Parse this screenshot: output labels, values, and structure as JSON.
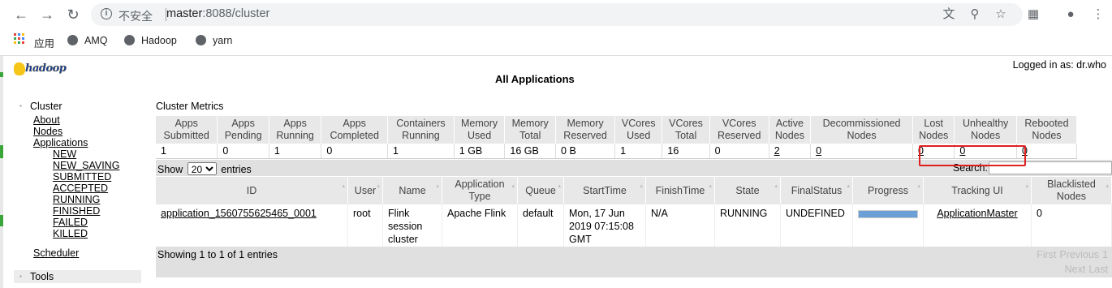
{
  "browser": {
    "insecure_label": "不安全",
    "url_host": "master",
    "url_rest": ":8088/cluster",
    "bookmarks": [
      "应用",
      "AMQ",
      "Hadoop",
      "yarn"
    ]
  },
  "header": {
    "logo_text": "hadoop",
    "logged_in": "Logged in as: dr.who",
    "title": "All Applications"
  },
  "nav": {
    "cluster_label": "Cluster",
    "cluster_links": [
      "About",
      "Nodes",
      "Applications"
    ],
    "app_states": [
      "NEW",
      "NEW_SAVING",
      "SUBMITTED",
      "ACCEPTED",
      "RUNNING",
      "FINISHED",
      "FAILED",
      "KILLED"
    ],
    "scheduler": "Scheduler",
    "tools": "Tools"
  },
  "metrics": {
    "label": "Cluster Metrics",
    "headers": [
      [
        "Apps",
        "Submitted"
      ],
      [
        "Apps",
        "Pending"
      ],
      [
        "Apps",
        "Running"
      ],
      [
        "Apps",
        "Completed"
      ],
      [
        "Containers",
        "Running"
      ],
      [
        "Memory",
        "Used"
      ],
      [
        "Memory",
        "Total"
      ],
      [
        "Memory",
        "Reserved"
      ],
      [
        "VCores",
        "Used"
      ],
      [
        "VCores",
        "Total"
      ],
      [
        "VCores",
        "Reserved"
      ],
      [
        "Active",
        "Nodes"
      ],
      [
        "Decommissioned",
        "Nodes"
      ],
      [
        "Lost",
        "Nodes"
      ],
      [
        "Unhealthy",
        "Nodes"
      ],
      [
        "Rebooted",
        "Nodes"
      ]
    ],
    "values": [
      "1",
      "0",
      "1",
      "0",
      "1",
      "1 GB",
      "16 GB",
      "0 B",
      "1",
      "16",
      "0",
      "2",
      "0",
      "0",
      "0",
      "0"
    ]
  },
  "controls": {
    "show": "Show",
    "page_size": "20",
    "entries": "entries",
    "search_label": "Search:"
  },
  "apps": {
    "headers": [
      [
        "ID"
      ],
      [
        "User"
      ],
      [
        "Name"
      ],
      [
        "Application",
        "Type"
      ],
      [
        "Queue"
      ],
      [
        "StartTime"
      ],
      [
        "FinishTime"
      ],
      [
        "State"
      ],
      [
        "FinalStatus"
      ],
      [
        "Progress"
      ],
      [
        "Tracking UI"
      ],
      [
        "Blacklisted",
        "Nodes"
      ]
    ],
    "row": {
      "id": "application_1560755625465_0001",
      "user": "root",
      "name": [
        "Flink",
        "session",
        "cluster"
      ],
      "type": "Apache Flink",
      "queue": "default",
      "start": [
        "Mon, 17 Jun",
        "2019 07:15:08",
        "GMT"
      ],
      "finish": "N/A",
      "state": "RUNNING",
      "final_status": "UNDEFINED",
      "progress": 1.0,
      "tracking": "ApplicationMaster",
      "blacklisted": "0"
    }
  },
  "footer": {
    "info": "Showing 1 to 1 of 1 entries",
    "first": "First",
    "previous": "Previous",
    "page": "1",
    "next": "Next",
    "last": "Last"
  }
}
